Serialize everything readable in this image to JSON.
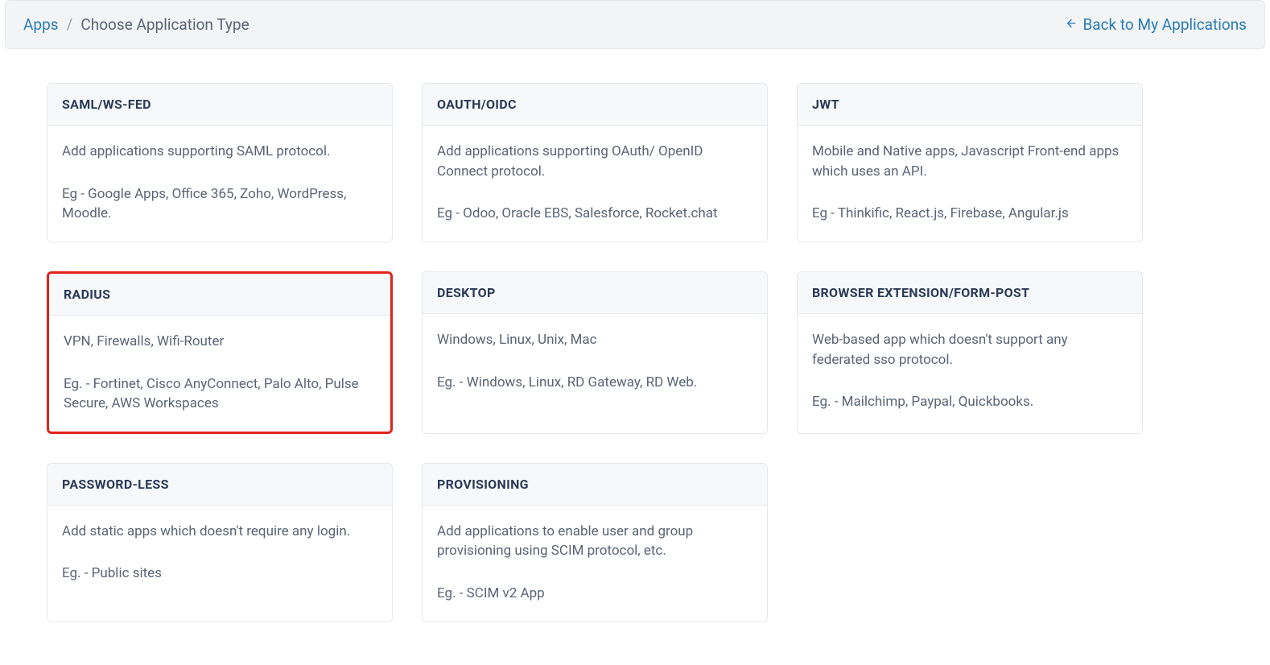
{
  "breadcrumb": {
    "root": "Apps",
    "sep": "/",
    "current": "Choose Application Type"
  },
  "back": {
    "label": "Back to My Applications"
  },
  "cards": [
    {
      "title": "SAML/WS-FED",
      "desc": "Add applications supporting SAML protocol.",
      "example": "Eg - Google Apps, Office 365, Zoho, WordPress, Moodle.",
      "highlight": false
    },
    {
      "title": "OAUTH/OIDC",
      "desc": "Add applications supporting OAuth/ OpenID Connect protocol.",
      "example": "Eg - Odoo, Oracle EBS, Salesforce, Rocket.chat",
      "highlight": false
    },
    {
      "title": "JWT",
      "desc": "Mobile and Native apps, Javascript Front-end apps which uses an API.",
      "example": "Eg - Thinkific, React.js, Firebase, Angular.js",
      "highlight": false
    },
    {
      "title": "RADIUS",
      "desc": "VPN, Firewalls, Wifi-Router",
      "example": "Eg. - Fortinet, Cisco AnyConnect, Palo Alto, Pulse Secure, AWS Workspaces",
      "highlight": true
    },
    {
      "title": "DESKTOP",
      "desc": "Windows, Linux, Unix, Mac",
      "example": "Eg. - Windows, Linux, RD Gateway, RD Web.",
      "highlight": false
    },
    {
      "title": "BROWSER EXTENSION/FORM-POST",
      "desc": "Web-based app which doesn't support any federated sso protocol.",
      "example": "Eg. - Mailchimp, Paypal, Quickbooks.",
      "highlight": false
    },
    {
      "title": "PASSWORD-LESS",
      "desc": "Add static apps which doesn't require any login.",
      "example": "Eg. - Public sites",
      "highlight": false
    },
    {
      "title": "PROVISIONING",
      "desc": "Add applications to enable user and group provisioning using SCIM protocol, etc.",
      "example": "Eg. - SCIM v2 App",
      "highlight": false
    }
  ]
}
